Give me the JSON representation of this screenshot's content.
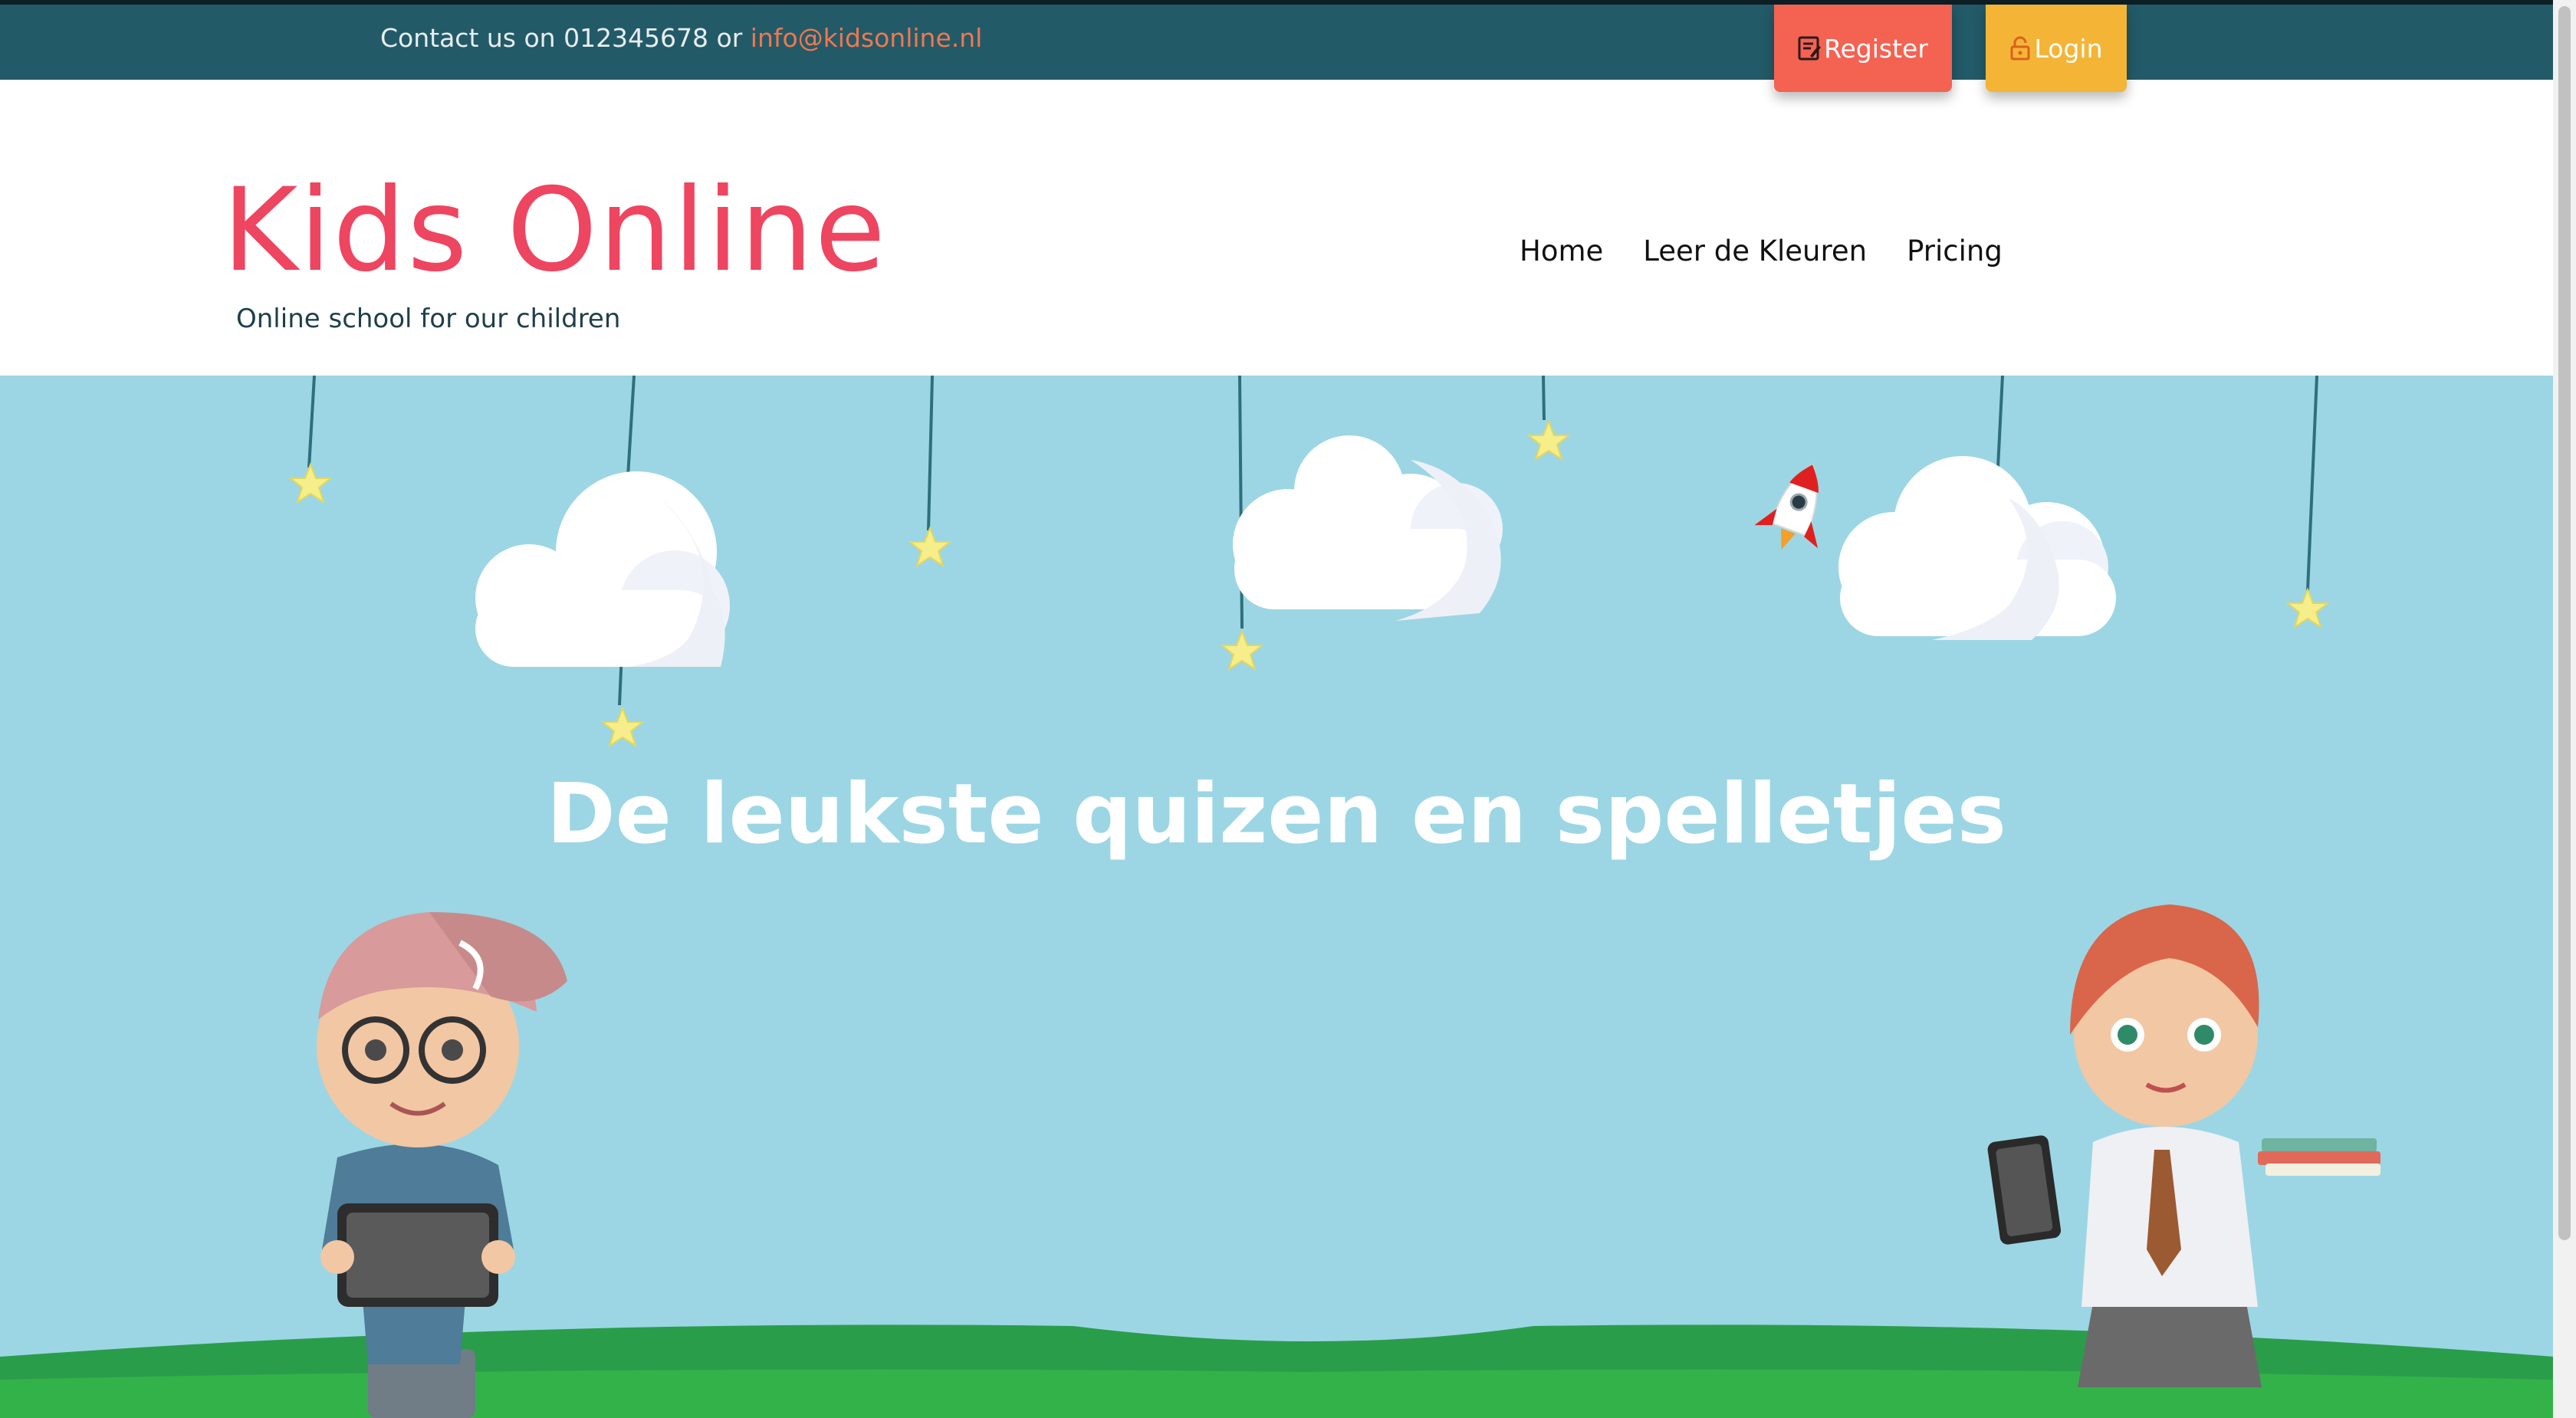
{
  "topbar": {
    "contact_text": "Contact us on 012345678 or ",
    "contact_email": "info@kidsonline.nl",
    "register_label": "Register",
    "login_label": "Login"
  },
  "header": {
    "brand_title": "Kids Online",
    "brand_subtitle": "Online school for our children",
    "nav": {
      "home": "Home",
      "colors": "Leer de Kleuren",
      "pricing": "Pricing"
    }
  },
  "hero": {
    "title": "De leukste quizen en spelletjes"
  },
  "colors": {
    "topbar_bg": "#235a68",
    "brand_red": "#ee4560",
    "register_bg": "#f46252",
    "login_bg": "#f4b536",
    "sky": "#9cd6e4",
    "grass": "#33b24a"
  }
}
